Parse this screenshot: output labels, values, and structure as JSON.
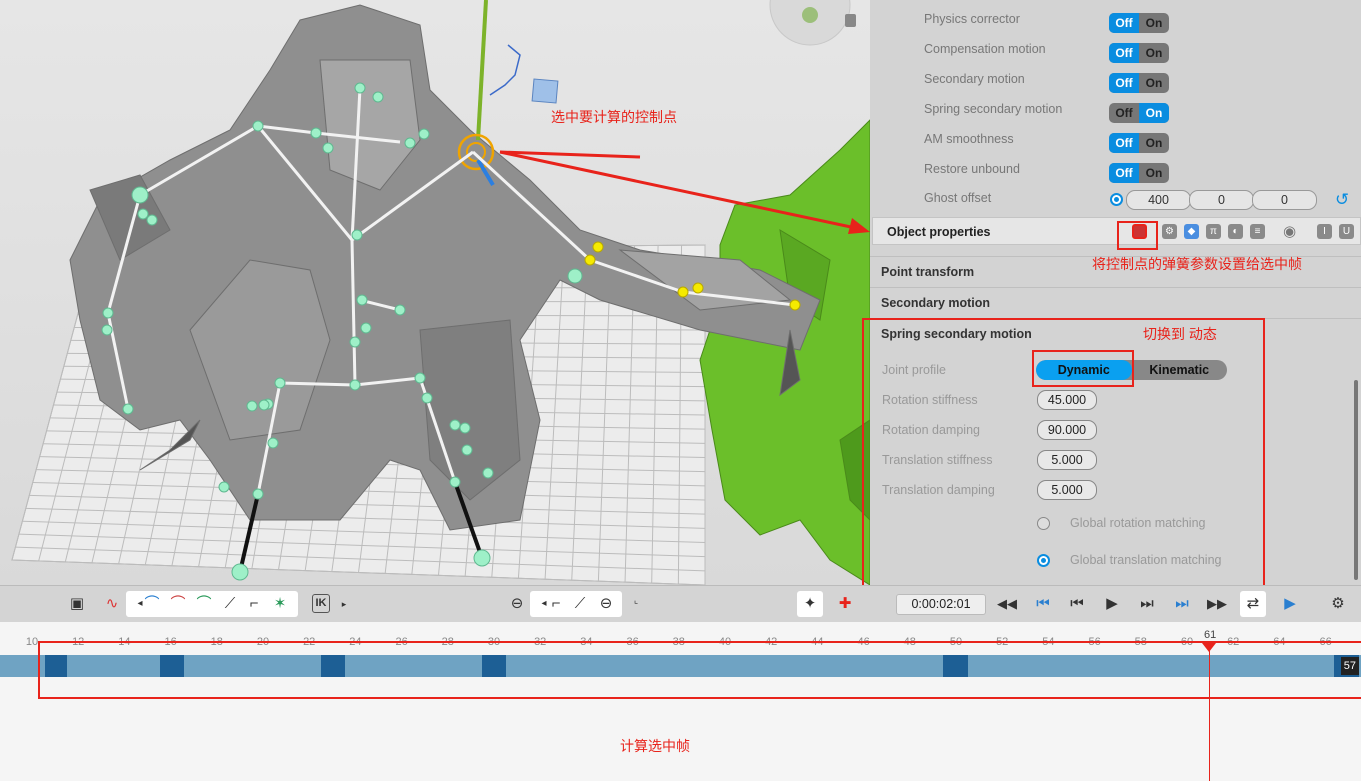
{
  "panel": {
    "motion_rows": [
      {
        "label": "Physics corrector",
        "off": "Off",
        "on": "On",
        "state": "off"
      },
      {
        "label": "Compensation motion",
        "off": "Off",
        "on": "On",
        "state": "off"
      },
      {
        "label": "Secondary motion",
        "off": "Off",
        "on": "On",
        "state": "off"
      },
      {
        "label": "Spring secondary motion",
        "off": "Off",
        "on": "On",
        "state": "on"
      },
      {
        "label": "AM smoothness",
        "off": "Off",
        "on": "On",
        "state": "off"
      },
      {
        "label": "Restore unbound",
        "off": "Off",
        "on": "On",
        "state": "off"
      }
    ],
    "ghost_offset": {
      "label": "Ghost offset",
      "values": [
        "400",
        "0",
        "0"
      ]
    },
    "object_properties_title": "Object properties",
    "sections": [
      "Point transform",
      "Secondary motion",
      "Spring secondary motion"
    ],
    "spring": {
      "joint_profile_label": "Joint profile",
      "joint_profile_options": [
        "Dynamic",
        "Kinematic"
      ],
      "joint_profile_selected": "Dynamic",
      "fields": [
        {
          "label": "Rotation stiffness",
          "value": "45.000"
        },
        {
          "label": "Rotation damping",
          "value": "90.000"
        },
        {
          "label": "Translation stiffness",
          "value": "5.000"
        },
        {
          "label": "Translation damping",
          "value": "5.000"
        }
      ],
      "global_rotation_matching": "Global rotation matching",
      "global_translation_matching": "Global translation matching",
      "selected_matching": "Global translation matching"
    }
  },
  "toolbar": {
    "ik_label": "IK",
    "timecode": "0:00:02:01"
  },
  "timeline": {
    "ticks": [
      "10",
      "12",
      "14",
      "16",
      "18",
      "20",
      "22",
      "24",
      "26",
      "28",
      "30",
      "32",
      "34",
      "36",
      "38",
      "40",
      "42",
      "44",
      "46",
      "48",
      "50",
      "52",
      "54",
      "56",
      "58",
      "60",
      "61",
      "62",
      "64",
      "66"
    ],
    "current_frame": "61",
    "end_frame": "57"
  },
  "annotations": {
    "select_control_point": "选中要计算的控制点",
    "apply_spring_params": "将控制点的弹簧参数设置给选中帧",
    "switch_to_dynamic": "切换到 动态",
    "calc_selected_frames": "计算选中帧"
  },
  "colors": {
    "accent": "#0a8de0",
    "annotation": "#e8231b",
    "keyframe": "#1d5f95",
    "track": "#6fa3c3"
  }
}
